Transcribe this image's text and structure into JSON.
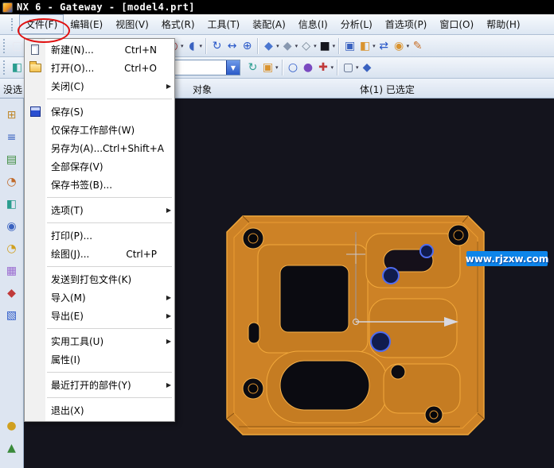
{
  "window": {
    "title": "NX 6 - Gateway - [model4.prt]"
  },
  "menubar": {
    "active_index": 0,
    "items": [
      {
        "id": "file",
        "label": "文件(F)"
      },
      {
        "id": "edit",
        "label": "编辑(E)"
      },
      {
        "id": "view",
        "label": "视图(V)"
      },
      {
        "id": "format",
        "label": "格式(R)"
      },
      {
        "id": "tools",
        "label": "工具(T)"
      },
      {
        "id": "assemblies",
        "label": "装配(A)"
      },
      {
        "id": "information",
        "label": "信息(I)"
      },
      {
        "id": "analysis",
        "label": "分析(L)"
      },
      {
        "id": "preferences",
        "label": "首选项(P)"
      },
      {
        "id": "window",
        "label": "窗口(O)"
      },
      {
        "id": "help",
        "label": "帮助(H)"
      }
    ]
  },
  "file_menu": {
    "items": [
      {
        "id": "new",
        "label": "新建(N)...",
        "shortcut": "Ctrl+N",
        "icon": "new"
      },
      {
        "id": "open",
        "label": "打开(O)...",
        "shortcut": "Ctrl+O",
        "icon": "open"
      },
      {
        "id": "close",
        "label": "关闭(C)",
        "submenu": true
      },
      {
        "separator": true
      },
      {
        "id": "save",
        "label": "保存(S)",
        "icon": "save"
      },
      {
        "id": "save-work-part",
        "label": "仅保存工作部件(W)"
      },
      {
        "id": "save-as",
        "label": "另存为(A)...",
        "shortcut": "Ctrl+Shift+A"
      },
      {
        "id": "save-all",
        "label": "全部保存(V)"
      },
      {
        "id": "save-bookmark",
        "label": "保存书签(B)..."
      },
      {
        "separator": true
      },
      {
        "id": "options",
        "label": "选项(T)",
        "submenu": true
      },
      {
        "separator": true
      },
      {
        "id": "print",
        "label": "打印(P)..."
      },
      {
        "id": "plot",
        "label": "绘图(J)...",
        "shortcut": "Ctrl+P"
      },
      {
        "separator": true
      },
      {
        "id": "send-package",
        "label": "发送到打包文件(K)"
      },
      {
        "id": "import",
        "label": "导入(M)",
        "submenu": true
      },
      {
        "id": "export",
        "label": "导出(E)",
        "submenu": true
      },
      {
        "separator": true
      },
      {
        "id": "utilities",
        "label": "实用工具(U)",
        "submenu": true
      },
      {
        "id": "properties",
        "label": "属性(I)"
      },
      {
        "separator": true
      },
      {
        "id": "recent-parts",
        "label": "最近打开的部件(Y)",
        "submenu": true
      },
      {
        "separator": true
      },
      {
        "id": "exit",
        "label": "退出(X)"
      }
    ]
  },
  "toolbar_row1": {
    "icons": [
      {
        "id": "new-part",
        "glyph": "▢",
        "color": "#e8e8f0"
      },
      {
        "id": "open-part",
        "glyph": "▨",
        "color": "#d9932f"
      },
      {
        "id": "save-part",
        "glyph": "▣",
        "color": "#2a58c8"
      },
      {
        "id": "undo",
        "glyph": "↺",
        "color": "#2a58c8"
      },
      {
        "id": "redo",
        "glyph": "↻",
        "color": "#8aa0c0"
      },
      {
        "sep": true
      },
      {
        "id": "sketch",
        "glyph": "✎",
        "color": "#1f6f8f",
        "dd": true
      },
      {
        "id": "extrude",
        "glyph": "◳",
        "color": "#c08a30",
        "dd": true
      },
      {
        "sep": true
      },
      {
        "id": "point-set",
        "glyph": "⊞",
        "color": "#3a62c0"
      },
      {
        "id": "datum-plane",
        "glyph": "⊠",
        "color": "#3a62c0"
      },
      {
        "id": "hole",
        "glyph": "◎",
        "color": "#b03030",
        "dd": true
      },
      {
        "id": "edge-blend",
        "glyph": "◖",
        "color": "#3a62c0",
        "dd": true
      },
      {
        "sep": true
      },
      {
        "id": "rotate-view",
        "glyph": "↻",
        "color": "#2a58c8"
      },
      {
        "id": "pan-view",
        "glyph": "↔",
        "color": "#2a58c8"
      },
      {
        "id": "zoom-view",
        "glyph": "⊕",
        "color": "#2a58c8"
      },
      {
        "sep": true
      },
      {
        "id": "orient-view",
        "glyph": "◆",
        "color": "#4a76d0",
        "dd": true
      },
      {
        "id": "shaded-display",
        "glyph": "◆",
        "color": "#8898b0",
        "dd": true
      },
      {
        "id": "wireframe-display",
        "glyph": "◇",
        "color": "#708090",
        "dd": true
      },
      {
        "id": "view-background",
        "glyph": "■",
        "color": "#15151d",
        "dd": true
      },
      {
        "sep": true
      },
      {
        "id": "new-window",
        "glyph": "▣",
        "color": "#3a62c0"
      },
      {
        "id": "orient-csys",
        "glyph": "◧",
        "color": "#d9932f",
        "dd": true
      },
      {
        "id": "move-object",
        "glyph": "⇄",
        "color": "#2a58c8"
      },
      {
        "id": "snap-point",
        "glyph": "◉",
        "color": "#d9932f",
        "dd": true
      },
      {
        "id": "edit-object-display",
        "glyph": "✎",
        "color": "#c8702a"
      }
    ]
  },
  "toolbar_row2": {
    "combo_value": "",
    "lead_icons": [
      {
        "id": "display-mode",
        "glyph": "◧",
        "color": "#2a9d8f"
      }
    ],
    "icons": [
      {
        "id": "refresh",
        "glyph": "↻",
        "color": "#2a9d8f"
      },
      {
        "id": "fit-view",
        "glyph": "▣",
        "color": "#d9932f",
        "dd": true
      },
      {
        "sep": true
      },
      {
        "id": "circle-tool",
        "glyph": "○",
        "color": "#2a58c8"
      },
      {
        "id": "sphere-tool",
        "glyph": "●",
        "color": "#7a4ac0"
      },
      {
        "id": "measure",
        "glyph": "✚",
        "color": "#c03a3a",
        "dd": true
      },
      {
        "sep": true
      },
      {
        "id": "selection-scope",
        "glyph": "▢",
        "color": "#506080",
        "dd": true
      },
      {
        "id": "solid-cube",
        "glyph": "◆",
        "color": "#3a62c0"
      }
    ]
  },
  "selection_bar": {
    "left_fragment": "没选",
    "prompt_fragment": "对象",
    "status": "体(1) 已选定"
  },
  "sidebar": {
    "icons": [
      {
        "id": "assembly-navigator",
        "glyph": "⊞",
        "color": "#c08a30"
      },
      {
        "id": "constraint-navigator",
        "glyph": "≡",
        "color": "#3a62c0"
      },
      {
        "id": "part-navigator",
        "glyph": "▤",
        "color": "#3a8a3a"
      },
      {
        "id": "reuse-library",
        "glyph": "◔",
        "color": "#c06a2a"
      },
      {
        "id": "hd3d-tools",
        "glyph": "◧",
        "color": "#2a9d8f"
      },
      {
        "id": "web-browser",
        "glyph": "◉",
        "color": "#3a62c0"
      },
      {
        "id": "history",
        "glyph": "◔",
        "color": "#d0a020"
      },
      {
        "id": "system-materials",
        "glyph": "▦",
        "color": "#9a6ad0"
      },
      {
        "id": "process-studio",
        "glyph": "◆",
        "color": "#c03a3a"
      },
      {
        "id": "manufacturing-wizards",
        "glyph": "▧",
        "color": "#2a58c8"
      },
      {
        "id": "roles",
        "glyph": "●",
        "color": "#d0a020"
      },
      {
        "id": "system-scenes",
        "glyph": "▲",
        "color": "#3a8a3a"
      }
    ]
  },
  "viewport": {
    "watermark": "www.rjzxw.com",
    "colors": {
      "background": "#14141d",
      "model_orange": "#cd8226",
      "edge_orange": "#f2a93c",
      "selected_blue": "#4f6cf0",
      "watermark_blue": "#0d85ea",
      "annotation_red": "#e01010"
    }
  }
}
